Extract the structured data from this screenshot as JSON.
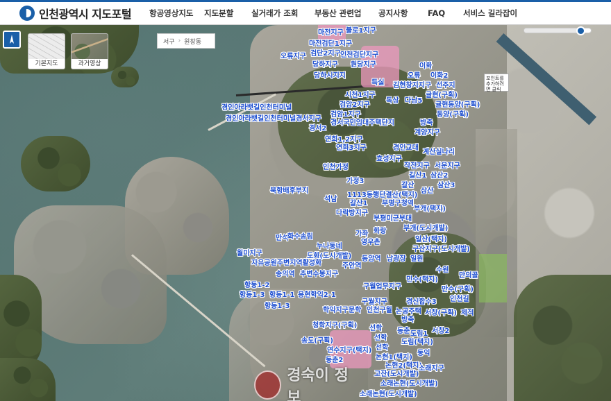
{
  "header": {
    "brand_title": "인천광역시 지도포털",
    "menu": [
      "항공영상지도",
      "지도분할",
      "실거래가 조회",
      "부동산 관련업",
      "공지사항",
      "FAQ",
      "서비스 길라잡이"
    ]
  },
  "controls": {
    "base_map_label": "기본지도",
    "aerial_label": "과거영상",
    "breadcrumb": [
      "서구",
      "원창동"
    ],
    "info_text": "포인트를 추가하려면 클릭",
    "opacity_level": 0.88
  },
  "map_labels": [
    "마전지구",
    "불로1지구",
    "마전검단1지구",
    "오류지구",
    "검단2지구",
    "인천검단지구",
    "당하지구",
    "원당지구",
    "당하시지지",
    "득실",
    "이화",
    "오류",
    "이화2",
    "김현창지지구",
    "선주지",
    "시천1지구",
    "검암2지구",
    "독상",
    "다남5",
    "귤현(구획)",
    "귤현동양(구획)",
    "경인아라뱃길인천터미널",
    "검암1지구",
    "동양(구획)",
    "경인아라뱃길인천터미널경서지구",
    "경서국민임대주택단지",
    "방축",
    "경서2",
    "계양지구",
    "연희1,2지구",
    "연희3지구",
    "경인교대",
    "계산실나리",
    "효성지구",
    "작전지구",
    "서운지구",
    "인천가정",
    "길산1",
    "삼산2",
    "가정3",
    "갈산",
    "삼산",
    "삼산3",
    "북항배후부지",
    "석남",
    "1113동행단결산(택지)",
    "갈산1",
    "부평구청역",
    "부개(택지)",
    "다락방지구",
    "부평미군부대",
    "부개(도시개발)",
    "만석",
    "화수송림",
    "가좌",
    "일산(택지)",
    "누나동네",
    "화랑",
    "영우촌",
    "구산지구(도시개발)",
    "월미지구",
    "도화(도시개발)",
    "자유공원주변지역활성화",
    "동암역",
    "남광장",
    "일원",
    "송의역",
    "주안역",
    "수원",
    "만의골",
    "추변수봉지구",
    "항동1-2",
    "민수(택지)",
    "항동1-3",
    "항동1-1",
    "용현학익2-1",
    "구월업무지구",
    "만수(구획)",
    "인천길",
    "항동1-3",
    "구월지구",
    "경신합수3",
    "학익지구",
    "문학",
    "인천구월",
    "논공주택",
    "서창(구획)",
    "제적",
    "방축",
    "청학지구(구획)",
    "선학",
    "동춘",
    "서창2",
    "도림1",
    "송도(구획)",
    "선학",
    "도림(택지)",
    "연수지구(택지)",
    "선학",
    "논현1(택지)",
    "동춘2",
    "동익",
    "논현2(택지)",
    "소래지구",
    "고잔(도시개발)",
    "소래논현(도시개발)",
    "소래논현(도시개발)"
  ],
  "watermark_text": "경숙이 정보"
}
